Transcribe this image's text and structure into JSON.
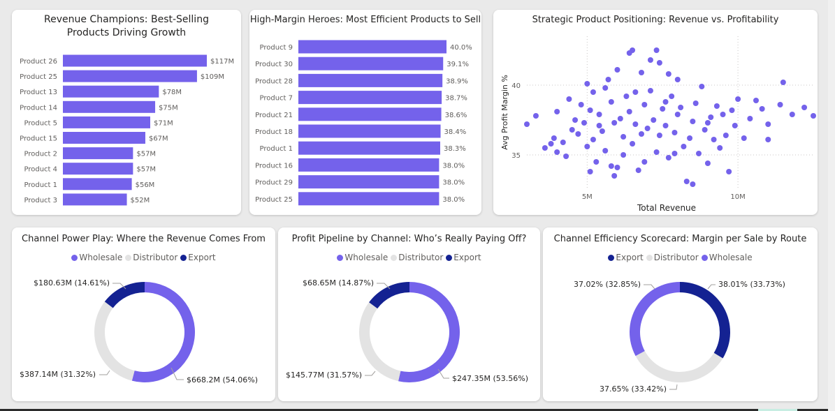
{
  "colors": {
    "purple": "#7462EB",
    "navy": "#142292",
    "light_gray": "#E3E3E3",
    "text": "#252423",
    "muted": "#605e5c"
  },
  "chart_data": [
    {
      "id": "revenue_champions",
      "type": "bar",
      "orientation": "horizontal",
      "title": "Revenue Champions: Best-Selling Products Driving Growth",
      "categories": [
        "Product 26",
        "Product 25",
        "Product 13",
        "Product 14",
        "Product 5",
        "Product 15",
        "Product 2",
        "Product 4",
        "Product 1",
        "Product 3"
      ],
      "values": [
        117,
        109,
        78,
        75,
        71,
        67,
        57,
        57,
        56,
        52
      ],
      "value_unit": "$M",
      "data_labels": [
        "$117M",
        "$109M",
        "$78M",
        "$75M",
        "$71M",
        "$67M",
        "$57M",
        "$57M",
        "$56M",
        "$52M"
      ],
      "xlim": [
        0,
        117
      ]
    },
    {
      "id": "high_margin_heroes",
      "type": "bar",
      "orientation": "horizontal",
      "title": "High-Margin Heroes: Most Efficient Products to Sell",
      "categories": [
        "Product 9",
        "Product 30",
        "Product 28",
        "Product 7",
        "Product 21",
        "Product 18",
        "Product 1",
        "Product 16",
        "Product 29",
        "Product 25"
      ],
      "values": [
        40.0,
        39.1,
        38.9,
        38.7,
        38.6,
        38.4,
        38.3,
        38.0,
        38.0,
        38.0
      ],
      "data_labels": [
        "40.0%",
        "39.1%",
        "38.9%",
        "38.7%",
        "38.6%",
        "38.4%",
        "38.3%",
        "38.0%",
        "38.0%",
        "38.0%"
      ],
      "xlim": [
        0,
        40.0
      ]
    },
    {
      "id": "strategic_positioning",
      "type": "scatter",
      "title": "Strategic Product Positioning: Revenue vs. Profitability",
      "xlabel": "Total Revenue",
      "ylabel": "Avg Profit Margin %",
      "xticks": [
        {
          "value": 5000000,
          "label": "5M"
        },
        {
          "value": 10000000,
          "label": "10M"
        }
      ],
      "yticks": [
        {
          "value": 35,
          "label": "35"
        },
        {
          "value": 40,
          "label": "40"
        }
      ],
      "xlim": [
        3000000,
        12500000
      ],
      "ylim": [
        32.5,
        43.5
      ],
      "grid": true,
      "points": [
        [
          3,
          37.2
        ],
        [
          3.3,
          37.8
        ],
        [
          3.6,
          35.5
        ],
        [
          3.8,
          35.8
        ],
        [
          4.0,
          38.1
        ],
        [
          4.2,
          35.9
        ],
        [
          4.0,
          35.2
        ],
        [
          3.9,
          36.2
        ],
        [
          4.4,
          39.0
        ],
        [
          4.6,
          37.5
        ],
        [
          4.7,
          36.5
        ],
        [
          4.8,
          38.6
        ],
        [
          4.9,
          37.3
        ],
        [
          5.0,
          40.1
        ],
        [
          5.1,
          38.2
        ],
        [
          5.2,
          36.1
        ],
        [
          5.0,
          35.6
        ],
        [
          5.1,
          33.8
        ],
        [
          5.3,
          34.5
        ],
        [
          5.4,
          37.1
        ],
        [
          5.5,
          36.7
        ],
        [
          5.6,
          39.8
        ],
        [
          5.7,
          40.4
        ],
        [
          5.8,
          38.8
        ],
        [
          5.6,
          35.3
        ],
        [
          5.8,
          34.2
        ],
        [
          5.9,
          33.5
        ],
        [
          6.0,
          41.1
        ],
        [
          6.1,
          37.6
        ],
        [
          6.2,
          36.3
        ],
        [
          6.3,
          39.2
        ],
        [
          6.4,
          38.1
        ],
        [
          6.5,
          35.8
        ],
        [
          6.6,
          37.2
        ],
        [
          6.7,
          33.9
        ],
        [
          6.8,
          40.9
        ],
        [
          6.5,
          42.5
        ],
        [
          6.4,
          42.3
        ],
        [
          6.9,
          38.6
        ],
        [
          7.0,
          36.9
        ],
        [
          7.1,
          39.6
        ],
        [
          7.2,
          37.5
        ],
        [
          7.3,
          35.2
        ],
        [
          7.4,
          36.4
        ],
        [
          7.5,
          38.3
        ],
        [
          7.6,
          37.1
        ],
        [
          7.7,
          34.8
        ],
        [
          7.3,
          42.5
        ],
        [
          7.4,
          41.6
        ],
        [
          7.7,
          40.8
        ],
        [
          7.8,
          39.2
        ],
        [
          7.9,
          36.6
        ],
        [
          8.0,
          37.9
        ],
        [
          8.1,
          38.4
        ],
        [
          8.2,
          35.6
        ],
        [
          8.3,
          33.1
        ],
        [
          8.4,
          36.2
        ],
        [
          8.5,
          37.4
        ],
        [
          8.6,
          38.7
        ],
        [
          8.7,
          35.1
        ],
        [
          8.8,
          39.9
        ],
        [
          8.9,
          36.8
        ],
        [
          9.0,
          34.4
        ],
        [
          9.1,
          37.7
        ],
        [
          9.2,
          36.1
        ],
        [
          9.3,
          38.5
        ],
        [
          9.4,
          35.5
        ],
        [
          9.5,
          37.9
        ],
        [
          9.6,
          36.4
        ],
        [
          9.7,
          33.8
        ],
        [
          9.8,
          38.2
        ],
        [
          9.9,
          37.1
        ],
        [
          10.0,
          39.0
        ],
        [
          10.2,
          36.2
        ],
        [
          10.4,
          37.6
        ],
        [
          10.6,
          38.9
        ],
        [
          10.8,
          38.3
        ],
        [
          11.0,
          37.2
        ],
        [
          11.4,
          38.6
        ],
        [
          11.8,
          37.9
        ],
        [
          12.2,
          38.4
        ],
        [
          12.5,
          37.8
        ],
        [
          11.5,
          40.2
        ],
        [
          11.0,
          36.1
        ],
        [
          6.2,
          35.0
        ],
        [
          6.0,
          34.1
        ],
        [
          5.4,
          37.9
        ],
        [
          5.2,
          39.5
        ],
        [
          7.1,
          41.8
        ],
        [
          6.6,
          39.5
        ],
        [
          4.5,
          36.8
        ],
        [
          4.3,
          34.9
        ],
        [
          6.8,
          36.5
        ],
        [
          7.6,
          38.8
        ],
        [
          8.5,
          32.9
        ],
        [
          5.9,
          37.3
        ],
        [
          6.9,
          34.5
        ],
        [
          7.9,
          35.1
        ],
        [
          8.0,
          40.4
        ],
        [
          9.0,
          37.3
        ]
      ]
    },
    {
      "id": "channel_power_play",
      "type": "pie",
      "donut": true,
      "title": "Channel Power Play: Where the Revenue Comes From",
      "legend": [
        "Wholesale",
        "Distributor",
        "Export"
      ],
      "slices": [
        {
          "name": "Wholesale",
          "value": 668.2,
          "label": "$668.2M (54.06%)",
          "color": "#7462EB"
        },
        {
          "name": "Distributor",
          "value": 387.14,
          "label": "$387.14M (31.32%)",
          "color": "#E3E3E3"
        },
        {
          "name": "Export",
          "value": 180.63,
          "label": "$180.63M (14.61%)",
          "color": "#142292"
        }
      ]
    },
    {
      "id": "profit_pipeline",
      "type": "pie",
      "donut": true,
      "title": "Profit Pipeline by Channel: Who’s Really Paying Off?",
      "legend": [
        "Wholesale",
        "Distributor",
        "Export"
      ],
      "slices": [
        {
          "name": "Wholesale",
          "value": 247.35,
          "label": "$247.35M (53.56%)",
          "color": "#7462EB"
        },
        {
          "name": "Distributor",
          "value": 145.77,
          "label": "$145.77M (31.57%)",
          "color": "#E3E3E3"
        },
        {
          "name": "Export",
          "value": 68.65,
          "label": "$68.65M (14.87%)",
          "color": "#142292"
        }
      ]
    },
    {
      "id": "channel_efficiency",
      "type": "pie",
      "donut": true,
      "title": "Channel Efficiency Scorecard: Margin per Sale by Route",
      "legend": [
        "Export",
        "Distributor",
        "Wholesale"
      ],
      "slices": [
        {
          "name": "Export",
          "value": 38.01,
          "label": "38.01% (33.73%)",
          "color": "#142292"
        },
        {
          "name": "Distributor",
          "value": 37.65,
          "label": "37.65% (33.42%)",
          "color": "#E3E3E3"
        },
        {
          "name": "Wholesale",
          "value": 37.02,
          "label": "37.02% (32.85%)",
          "color": "#7462EB"
        }
      ]
    }
  ]
}
